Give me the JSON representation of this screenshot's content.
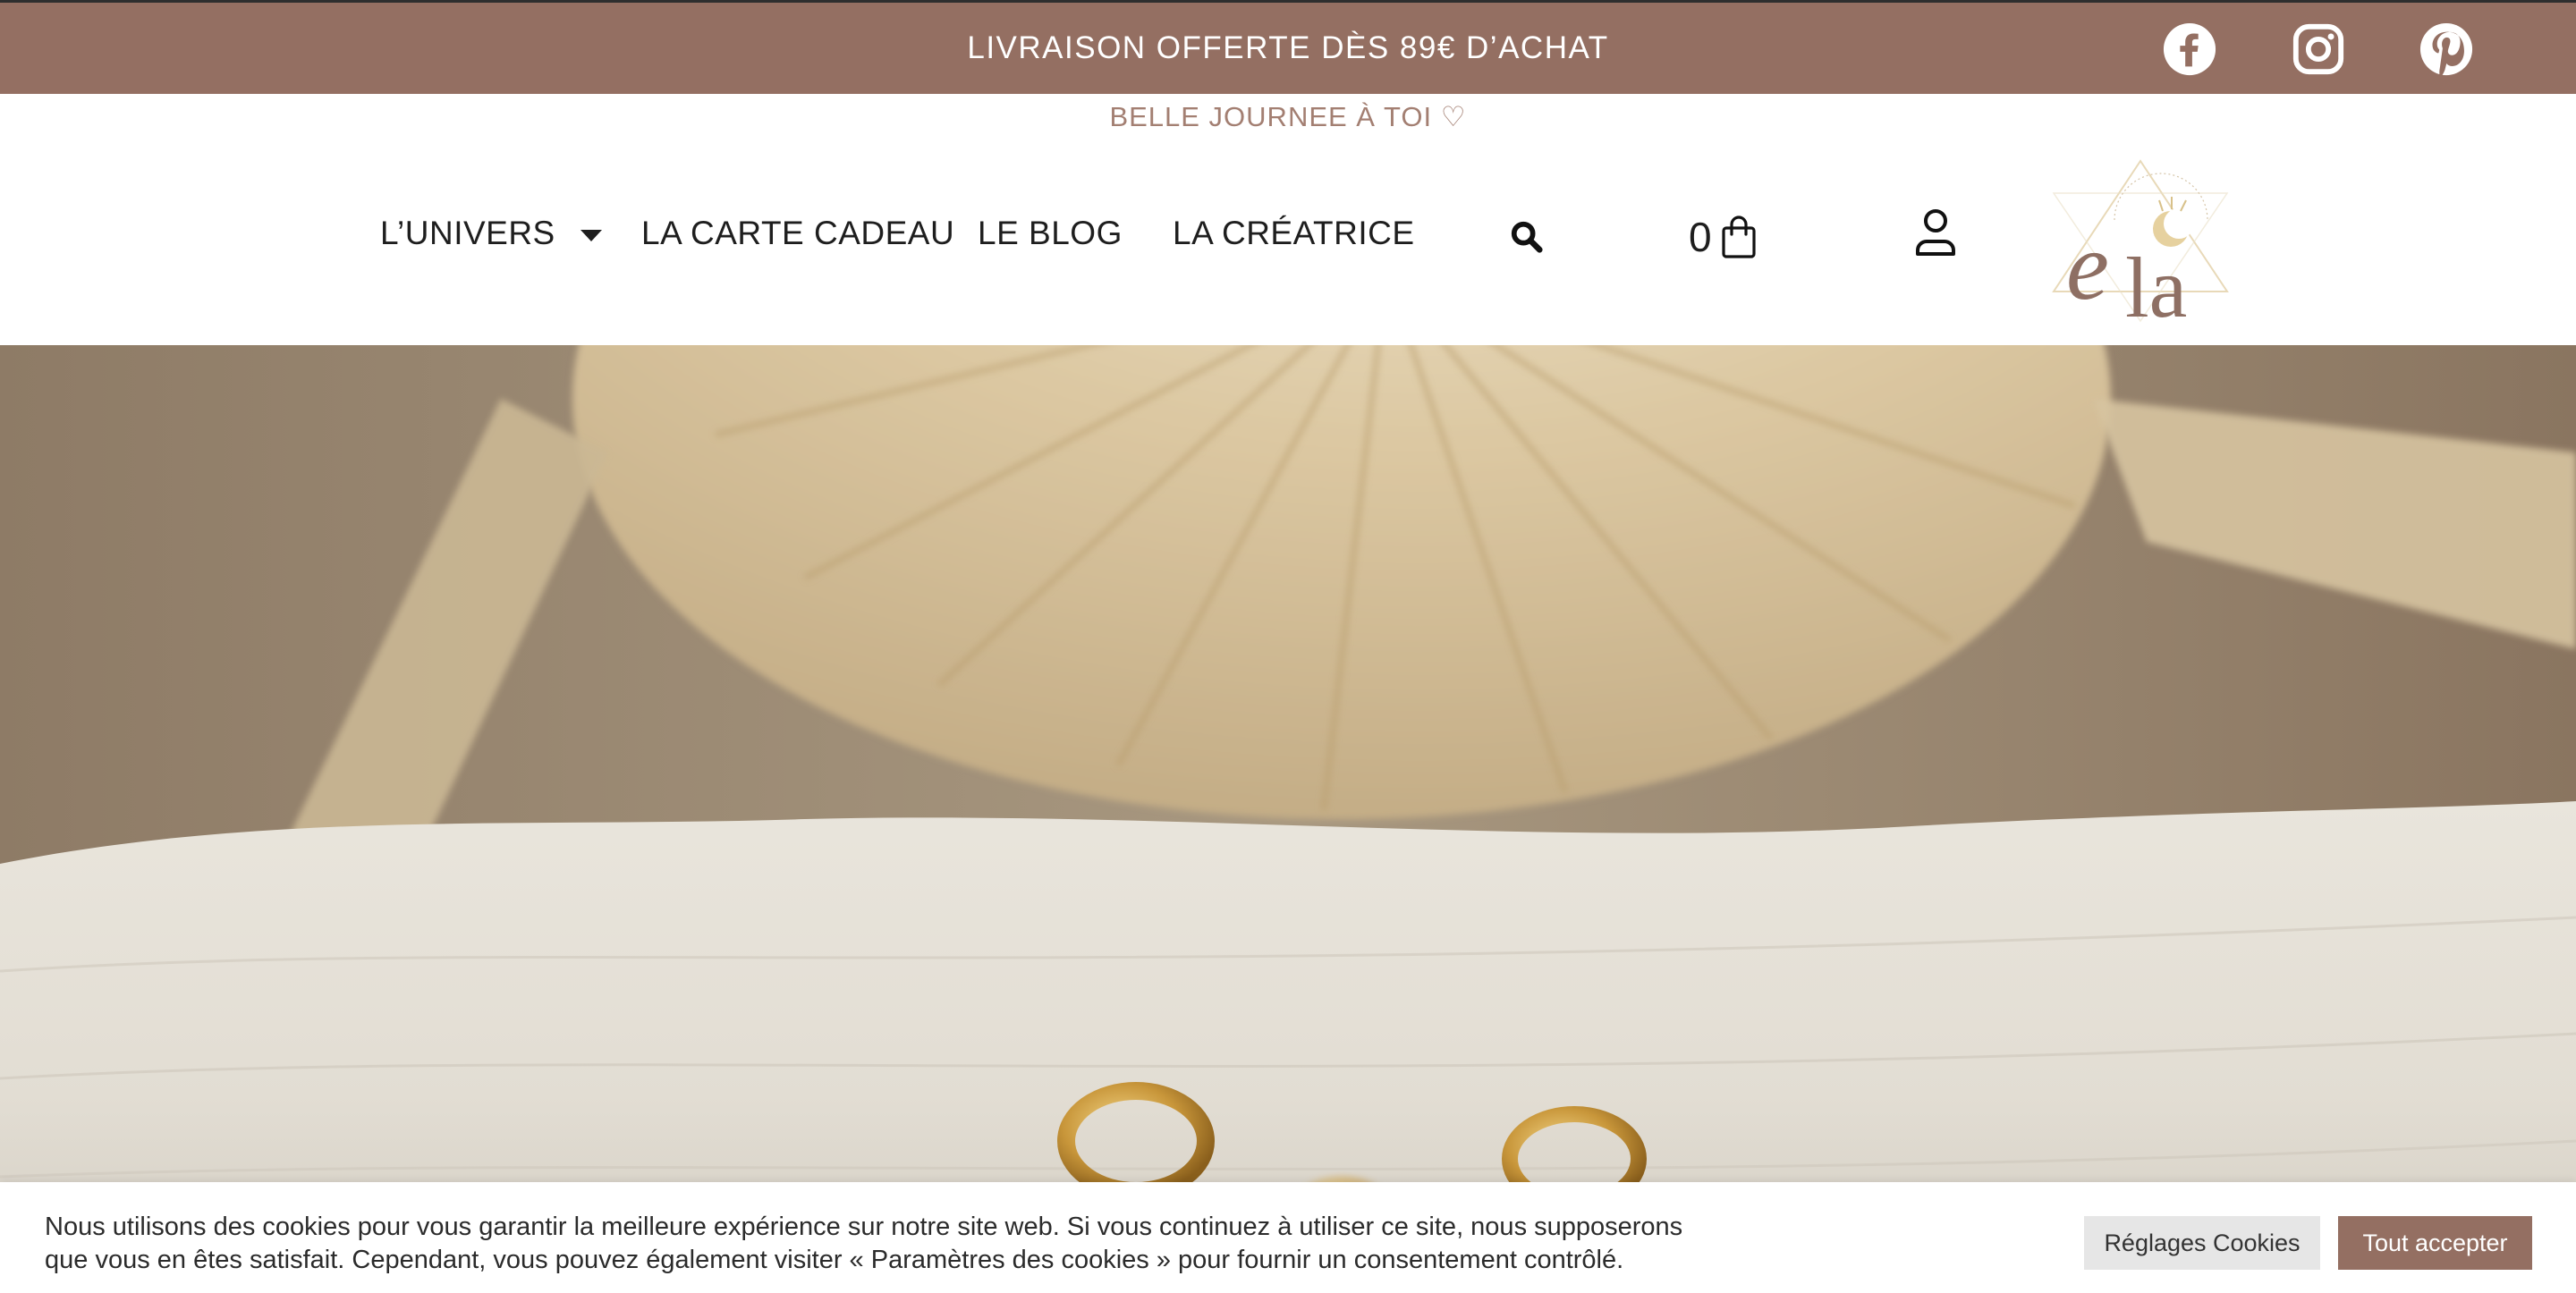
{
  "topbar": {
    "promo": "LIVRAISON OFFERTE DÈS 89€ D’ACHAT",
    "background": "#946f62",
    "social": [
      "facebook-icon",
      "instagram-icon",
      "pinterest-icon"
    ]
  },
  "subline": "BELLE JOURNEE À TOI ♡",
  "nav": {
    "items": [
      {
        "label": "L’UNIVERS"
      },
      {
        "label": "LA CARTE CADEAU"
      },
      {
        "label": "LE BLOG"
      },
      {
        "label": "LA CRÉATRICE"
      }
    ],
    "cart_count": "0"
  },
  "cookie": {
    "text_line1": "Nous utilisons des cookies pour vous garantir la meilleure expérience sur notre site web. Si vous continuez à utiliser ce site, nous supposerons",
    "text_line2": "que vous en êtes satisfait. Cependant, vous pouvez également visiter « Paramètres des cookies » pour fournir un consentement contrôlé.",
    "settings_label": "Réglages Cookies",
    "accept_label": "Tout accepter",
    "accent": "#946f62"
  }
}
